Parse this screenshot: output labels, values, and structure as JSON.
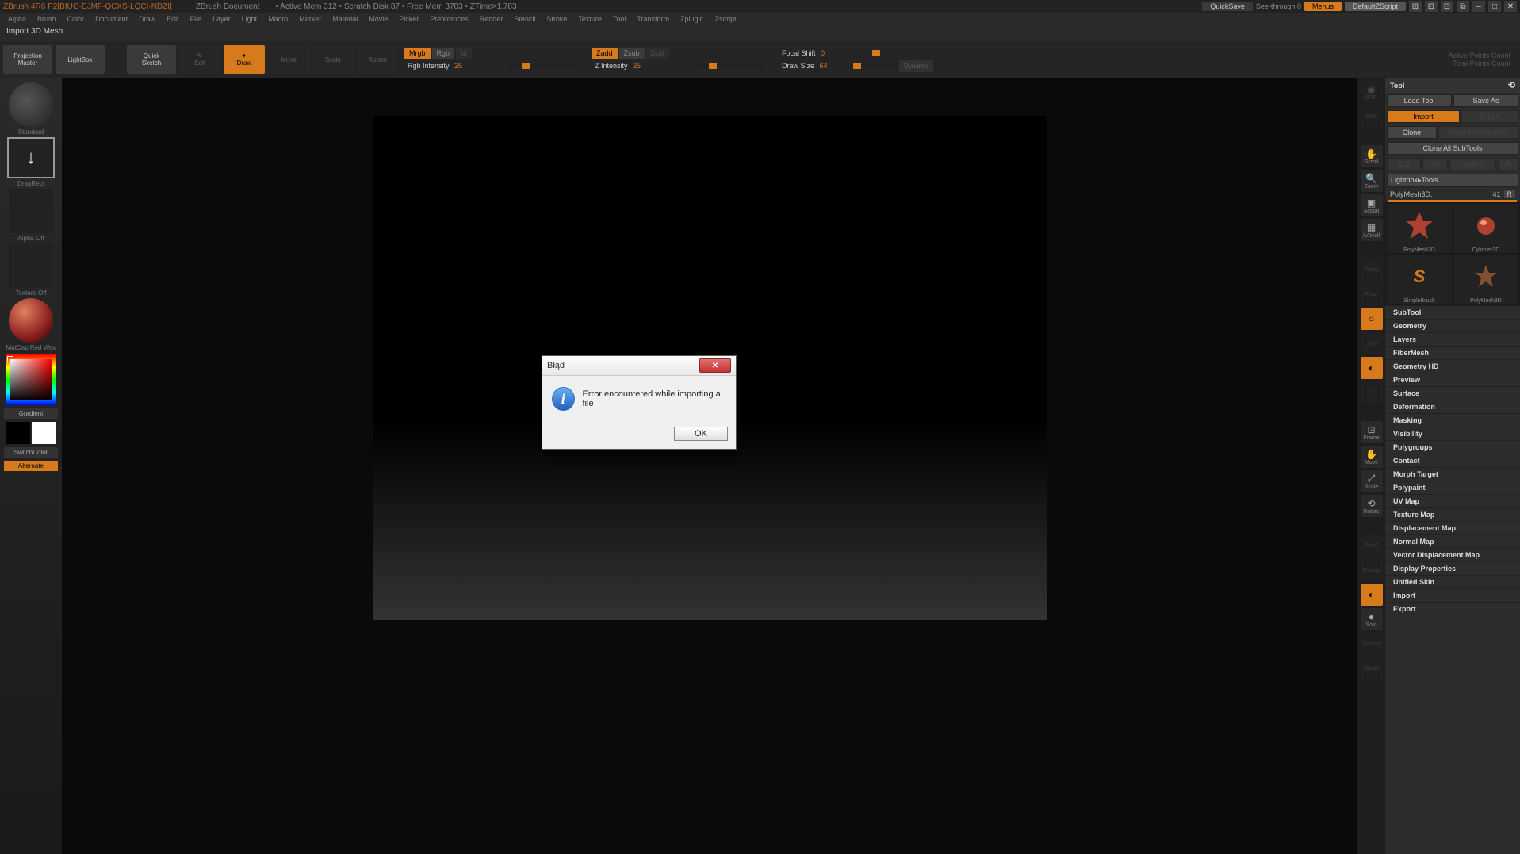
{
  "title": {
    "app": "ZBrush 4R6 P2[BIUG-EJMF-QCXS-LQCI-NDZI]",
    "doc": "ZBrush Document",
    "mem": "Active Mem 312",
    "scratch": "Scratch Disk 87",
    "free": "Free Mem 3783",
    "ztime": "ZTime>1.783"
  },
  "titleright": {
    "quicksave": "QuickSave",
    "seethrough": "See-through  0",
    "menus": "Menus",
    "script": "DefaultZScript"
  },
  "menus": [
    "Alpha",
    "Brush",
    "Color",
    "Document",
    "Draw",
    "Edit",
    "File",
    "Layer",
    "Light",
    "Macro",
    "Marker",
    "Material",
    "Movie",
    "Picker",
    "Preferences",
    "Render",
    "Stencil",
    "Stroke",
    "Texture",
    "Tool",
    "Transform",
    "Zplugin",
    "Zscript"
  ],
  "subheader": "Import 3D Mesh",
  "toolbar": {
    "projection": "Projection\nMaster",
    "lightbox": "LightBox",
    "quicksketch": "Quick\nSketch",
    "edit": "Edit",
    "draw": "Draw",
    "move": "Move",
    "scale": "Scale",
    "rotate": "Rotate",
    "mrgb": "Mrgb",
    "rgb": "Rgb",
    "m": "M",
    "rgbint": "Rgb Intensity",
    "rgbintv": "25",
    "zadd": "Zadd",
    "zsub": "Zsub",
    "zcut": "Zcut",
    "zint": "Z Intensity",
    "zintv": "25",
    "focal": "Focal Shift",
    "focalv": "0",
    "drawsize": "Draw Size",
    "drawsizev": "64",
    "dynamic": "Dynamic",
    "apc": "Active Points Count",
    "tpc": "Total Points Count"
  },
  "left": {
    "standard": "Standard",
    "stroke": "DragRect",
    "alpha": "Alpha Off",
    "texture": "Texture Off",
    "material": "MatCap Red Wax",
    "gradient": "Gradient",
    "switch": "SwitchColor",
    "alt": "Alternate"
  },
  "shelf": [
    "BPR",
    "SPix",
    "Scroll",
    "Zoom",
    "Actual",
    "AAHalf",
    "Persp",
    "Floor",
    "Local",
    "LSym",
    "Frame",
    "Move",
    "Scale",
    "Rotate",
    "PolyF",
    "Transp",
    "Ghost",
    "Solo",
    "Dynamic",
    "Xpose"
  ],
  "tool": {
    "title": "Tool",
    "load": "Load Tool",
    "saveas": "Save As",
    "import": "Import",
    "export": "Export",
    "clone": "Clone",
    "makepm": "Make PolyMesh3D",
    "cloneall": "Clone All SubTools",
    "goz": "GoZ",
    "all": "All",
    "visible": "Visible",
    "r": "R",
    "lightbox": "Lightbox▸Tools",
    "polymesh": "PolyMesh3D.",
    "polycnt": "41",
    "rbtn": "R",
    "grid": [
      "PolyMesh3D",
      "Cylinder3D",
      "PolyMesh3D",
      "SimpleBrush"
    ],
    "sections": [
      "SubTool",
      "Geometry",
      "Layers",
      "FiberMesh",
      "Geometry HD",
      "Preview",
      "Surface",
      "Deformation",
      "Masking",
      "Visibility",
      "Polygroups",
      "Contact",
      "Morph Target",
      "Polypaint",
      "UV Map",
      "Texture Map",
      "Displacement Map",
      "Normal Map",
      "Vector Displacement Map",
      "Display Properties",
      "Unified Skin",
      "Import",
      "Export"
    ]
  },
  "dialog": {
    "title": "Błąd",
    "msg": "Error encountered while importing a file",
    "ok": "OK"
  }
}
